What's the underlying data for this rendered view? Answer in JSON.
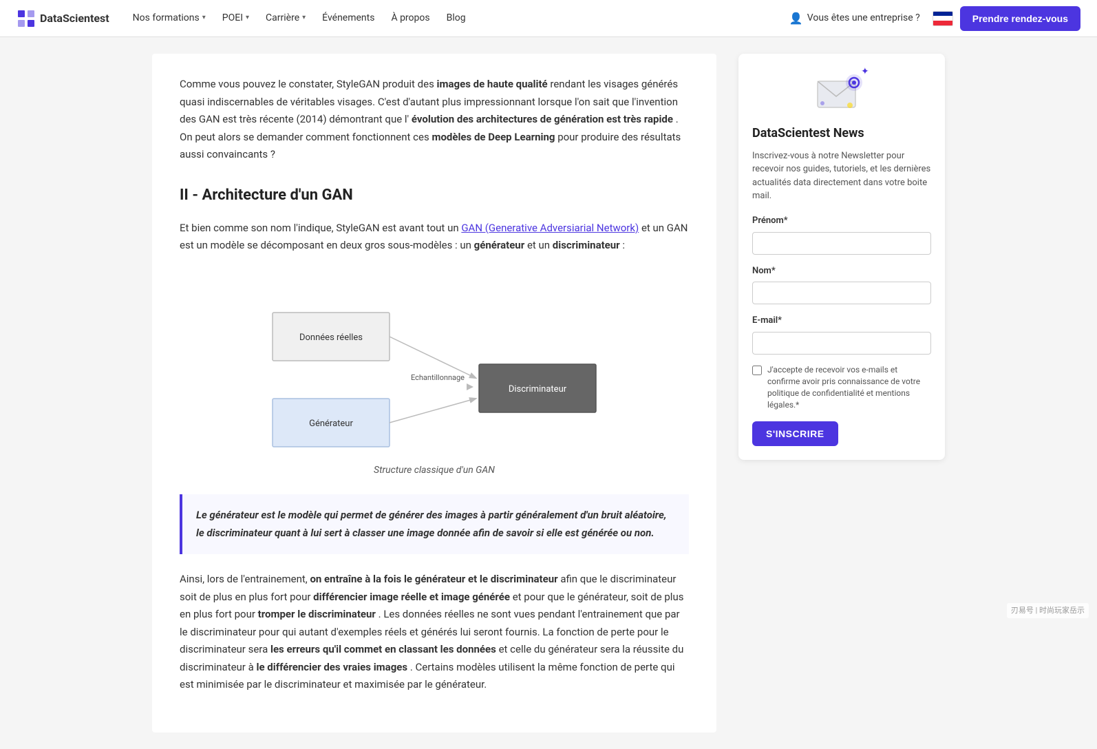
{
  "brand": {
    "name": "DataScientest",
    "logo_text": "DataScientest"
  },
  "nav": {
    "formations_label": "Nos formations",
    "formations_chevron": "▾",
    "poei_label": "POEI",
    "poei_chevron": "▾",
    "carriere_label": "Carrière",
    "carriere_chevron": "▾",
    "evenements_label": "Événements",
    "apropos_label": "À propos",
    "blog_label": "Blog",
    "enterprise_label": "Vous êtes une entreprise ?",
    "cta_label": "Prendre rendez-vous"
  },
  "article": {
    "paragraph1": "Comme vous pouvez le constater, StyleGAN produit des ",
    "paragraph1_bold": "images de haute qualité",
    "paragraph1_rest": " rendant les visages générés quasi indiscernables de véritables visages. C'est d'autant plus impressionnant lorsque l'on sait que l'invention des GAN est très récente (2014) démontrant que l'",
    "paragraph1_bold2": "évolution des architectures de génération est très rapide",
    "paragraph1_rest2": ". On peut alors se demander comment fonctionnent ces ",
    "paragraph1_bold3": "modèles de Deep Learning",
    "paragraph1_rest3": " pour produire des résultats aussi convaincants ?",
    "section2_heading": "II - Architecture d'un GAN",
    "paragraph2_start": "Et bien comme son nom l'indique, StyleGAN est avant tout un ",
    "paragraph2_link": "GAN (Generative Adversiarial Network)",
    "paragraph2_middle": " et un GAN est un modèle se décomposant en deux gros sous-modèles : un ",
    "paragraph2_bold1": "générateur",
    "paragraph2_and": " et un ",
    "paragraph2_bold2": "discriminateur",
    "paragraph2_end": " :",
    "diagram_caption": "Structure classique d'un GAN",
    "diagram_node1": "Données réelles",
    "diagram_node2": "Echantillonnage",
    "diagram_node3": "Discriminateur",
    "diagram_node4": "Générateur",
    "blockquote": "Le générateur est le modèle qui permet de générer des images à partir généralement d'un bruit aléatoire, le discriminateur quant à lui sert à classer une image donnée afin de savoir si elle est générée ou non.",
    "paragraph3_start": "Ainsi, lors de l'entrainement, ",
    "paragraph3_bold1": "on entraîne à la fois le générateur et le discriminateur",
    "paragraph3_rest1": " afin que le discriminateur soit de plus en plus fort pour ",
    "paragraph3_bold2": "différencier image réelle et image générée",
    "paragraph3_rest2": " et pour que le générateur, soit de plus en plus fort pour ",
    "paragraph3_bold3": "tromper le discriminateur",
    "paragraph3_rest3": ". Les données réelles ne sont vues pendant l'entrainement que par le discriminateur pour qui autant d'exemples réels et générés lui seront fournis. La fonction de perte pour le discriminateur sera ",
    "paragraph3_bold4": "les erreurs qu'il commet en classant les données",
    "paragraph3_rest4": " et celle du générateur sera la réussite du discriminateur à ",
    "paragraph3_bold5": "le différencier des vraies images",
    "paragraph3_rest5": ". Certains modèles utilisent la même fonction de perte qui est minimisée par le discriminateur et maximisée par le générateur."
  },
  "newsletter": {
    "title": "DataScientest News",
    "description": "Inscrivez-vous à notre Newsletter pour recevoir nos guides, tutoriels, et les dernières actualités data directement dans votre boite mail.",
    "prenom_label": "Prénom*",
    "nom_label": "Nom*",
    "email_label": "E-mail*",
    "prenom_placeholder": "",
    "nom_placeholder": "",
    "email_placeholder": "",
    "checkbox_text": "J'accepte de recevoir vos e-mails et confirme avoir pris connaissance de votre politique de confidentialité et mentions légales.*",
    "subscribe_btn": "S'INSCRIRE"
  },
  "watermark": "刃易号 | 时尚玩家岳示"
}
